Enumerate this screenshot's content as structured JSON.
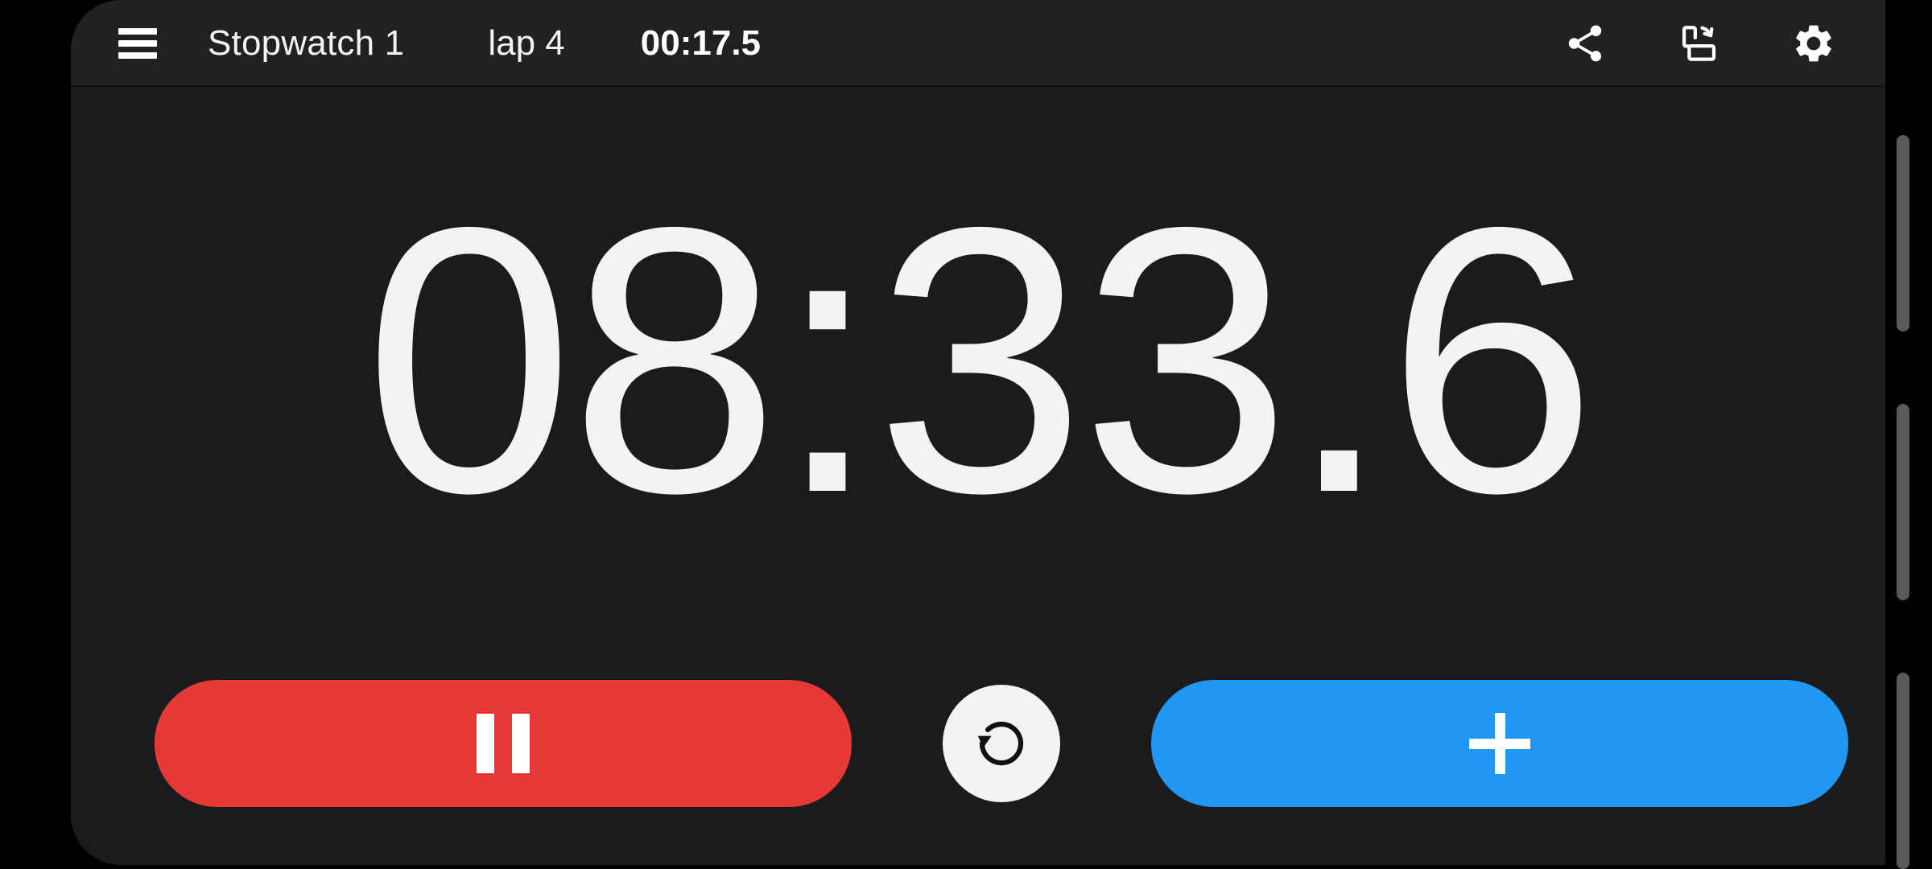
{
  "app": {
    "window_background": "#1b1b1d",
    "appbar_background": "#212124",
    "page_background": "#000000"
  },
  "appbar": {
    "menu_icon": "hamburger-menu-icon",
    "title": "Stopwatch 1",
    "lap_label": "lap 4",
    "lap_time": "00:17.5",
    "actions": [
      {
        "name": "share-icon",
        "label": "Share"
      },
      {
        "name": "screen-rotation-icon",
        "label": "Rotate screen"
      },
      {
        "name": "settings-gear-icon",
        "label": "Settings"
      }
    ]
  },
  "display": {
    "main_time": "08:33.6",
    "text_color": "#f1f3f4"
  },
  "controls": {
    "pause": {
      "name": "pause-button",
      "icon": "pause-icon",
      "label": "",
      "color": "#e53935"
    },
    "reset": {
      "name": "reset-button",
      "icon": "reset-rotate-ccw-icon",
      "label": "",
      "background": "#f1f3f4",
      "icon_color": "#111111"
    },
    "lap": {
      "name": "add-lap-button",
      "icon": "plus-icon",
      "label": "",
      "color": "#2196f3"
    }
  },
  "edge_indicator": {
    "bar_color": "#5a5a5c",
    "count": 3
  }
}
